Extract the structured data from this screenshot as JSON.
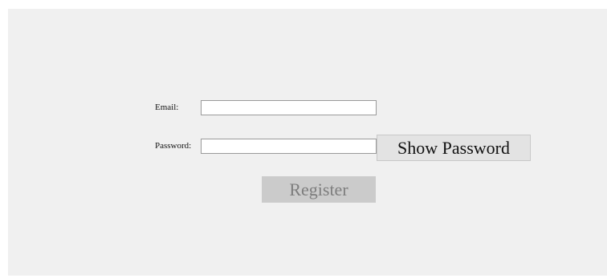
{
  "form": {
    "email_label": "Email:",
    "email_value": "",
    "email_placeholder": "",
    "password_label": "Password:",
    "password_value": "",
    "password_placeholder": "",
    "show_password_label": "Show Password",
    "register_label": "Register"
  },
  "colors": {
    "background": "#f0f0f0",
    "input_background": "#ffffff",
    "show_button_background": "#e3e3e3",
    "register_button_background": "#cbcbcb",
    "register_text": "#7d7d7d"
  }
}
